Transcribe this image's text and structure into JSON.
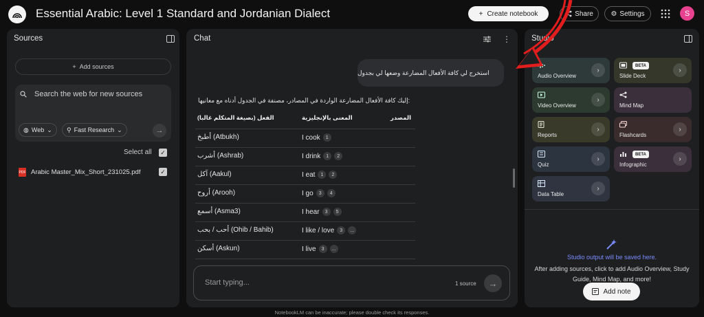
{
  "app": {
    "title": "Essential Arabic: Level 1 Standard and Jordanian Dialect",
    "avatar_letter": "S"
  },
  "header": {
    "create_label": "Create notebook",
    "share_label": "Share",
    "settings_label": "Settings"
  },
  "sources": {
    "title": "Sources",
    "add_label": "Add sources",
    "search_placeholder": "Search the web for new sources",
    "web_chip": "Web",
    "research_chip": "Fast Research",
    "select_all": "Select all",
    "items": [
      {
        "name": "Arabic Master_Mix_Short_231025.pdf",
        "type_label": "PDF"
      }
    ]
  },
  "chat": {
    "title": "Chat",
    "user_message": "استخرج لي كافة الأفعال المضارعة وضعها لي بجدول",
    "intro": ":إليك كافة الأفعال المضارعة الواردة في المصادر، مصنفة في الجدول أدناه مع معانيها",
    "headers": [
      "الفعل (بصيغة المتكلم غالبا)",
      "المعنى بالإنجليزية",
      "المصدر"
    ],
    "rows": [
      {
        "verb": "أطبخ (Atbukh)",
        "meaning": "I cook",
        "cites": [
          "1"
        ]
      },
      {
        "verb": "أشرب (Ashrab)",
        "meaning": "I drink",
        "cites": [
          "1",
          "2"
        ]
      },
      {
        "verb": "آكل (Aakul)",
        "meaning": "I eat",
        "cites": [
          "1",
          "2"
        ]
      },
      {
        "verb": "أروح (Arooh)",
        "meaning": "I go",
        "cites": [
          "3",
          "4"
        ]
      },
      {
        "verb": "أسمع (Asma3)",
        "meaning": "I hear",
        "cites": [
          "3",
          "5"
        ]
      },
      {
        "verb": "أحب / بحب (Ohib / Bahib)",
        "meaning": "I like / love",
        "cites": [
          "3",
          "..."
        ]
      },
      {
        "verb": "أسكن (Askun)",
        "meaning": "I live",
        "cites": [
          "3",
          "..."
        ]
      }
    ],
    "composer_placeholder": "Start typing...",
    "source_count": "1 source"
  },
  "studio": {
    "title": "Studio",
    "beta_label": "BETA",
    "cards": [
      {
        "label": "Audio Overview",
        "color": "#2e3a3a",
        "icon": "audio-icon",
        "beta": false
      },
      {
        "label": "Slide Deck",
        "color": "#34372a",
        "icon": "slides-icon",
        "beta": true
      },
      {
        "label": "Video Overview",
        "color": "#2c3a2f",
        "icon": "video-icon",
        "beta": false
      },
      {
        "label": "Mind Map",
        "color": "#3a2f3a",
        "icon": "mindmap-icon",
        "beta": false
      },
      {
        "label": "Reports",
        "color": "#3a3a2a",
        "icon": "reports-icon",
        "beta": false
      },
      {
        "label": "Flashcards",
        "color": "#3a2c2c",
        "icon": "flashcards-icon",
        "beta": false
      },
      {
        "label": "Quiz",
        "color": "#2c3440",
        "icon": "quiz-icon",
        "beta": false
      },
      {
        "label": "Infographic",
        "color": "#3a2f3a",
        "icon": "infographic-icon",
        "beta": true
      },
      {
        "label": "Data Table",
        "color": "#2f3440",
        "icon": "table-icon",
        "beta": false
      }
    ],
    "output_title": "Studio output will be saved here.",
    "output_desc": "After adding sources, click to add Audio Overview, Study Guide, Mind Map, and more!",
    "add_note_label": "Add note"
  },
  "footer": {
    "disclaimer": "NotebookLM can be inaccurate; please double check its responses."
  },
  "colors": {
    "annotation_red": "#e11d1d",
    "accent_blue": "#7b8cff",
    "avatar_pink": "#e8418f"
  }
}
